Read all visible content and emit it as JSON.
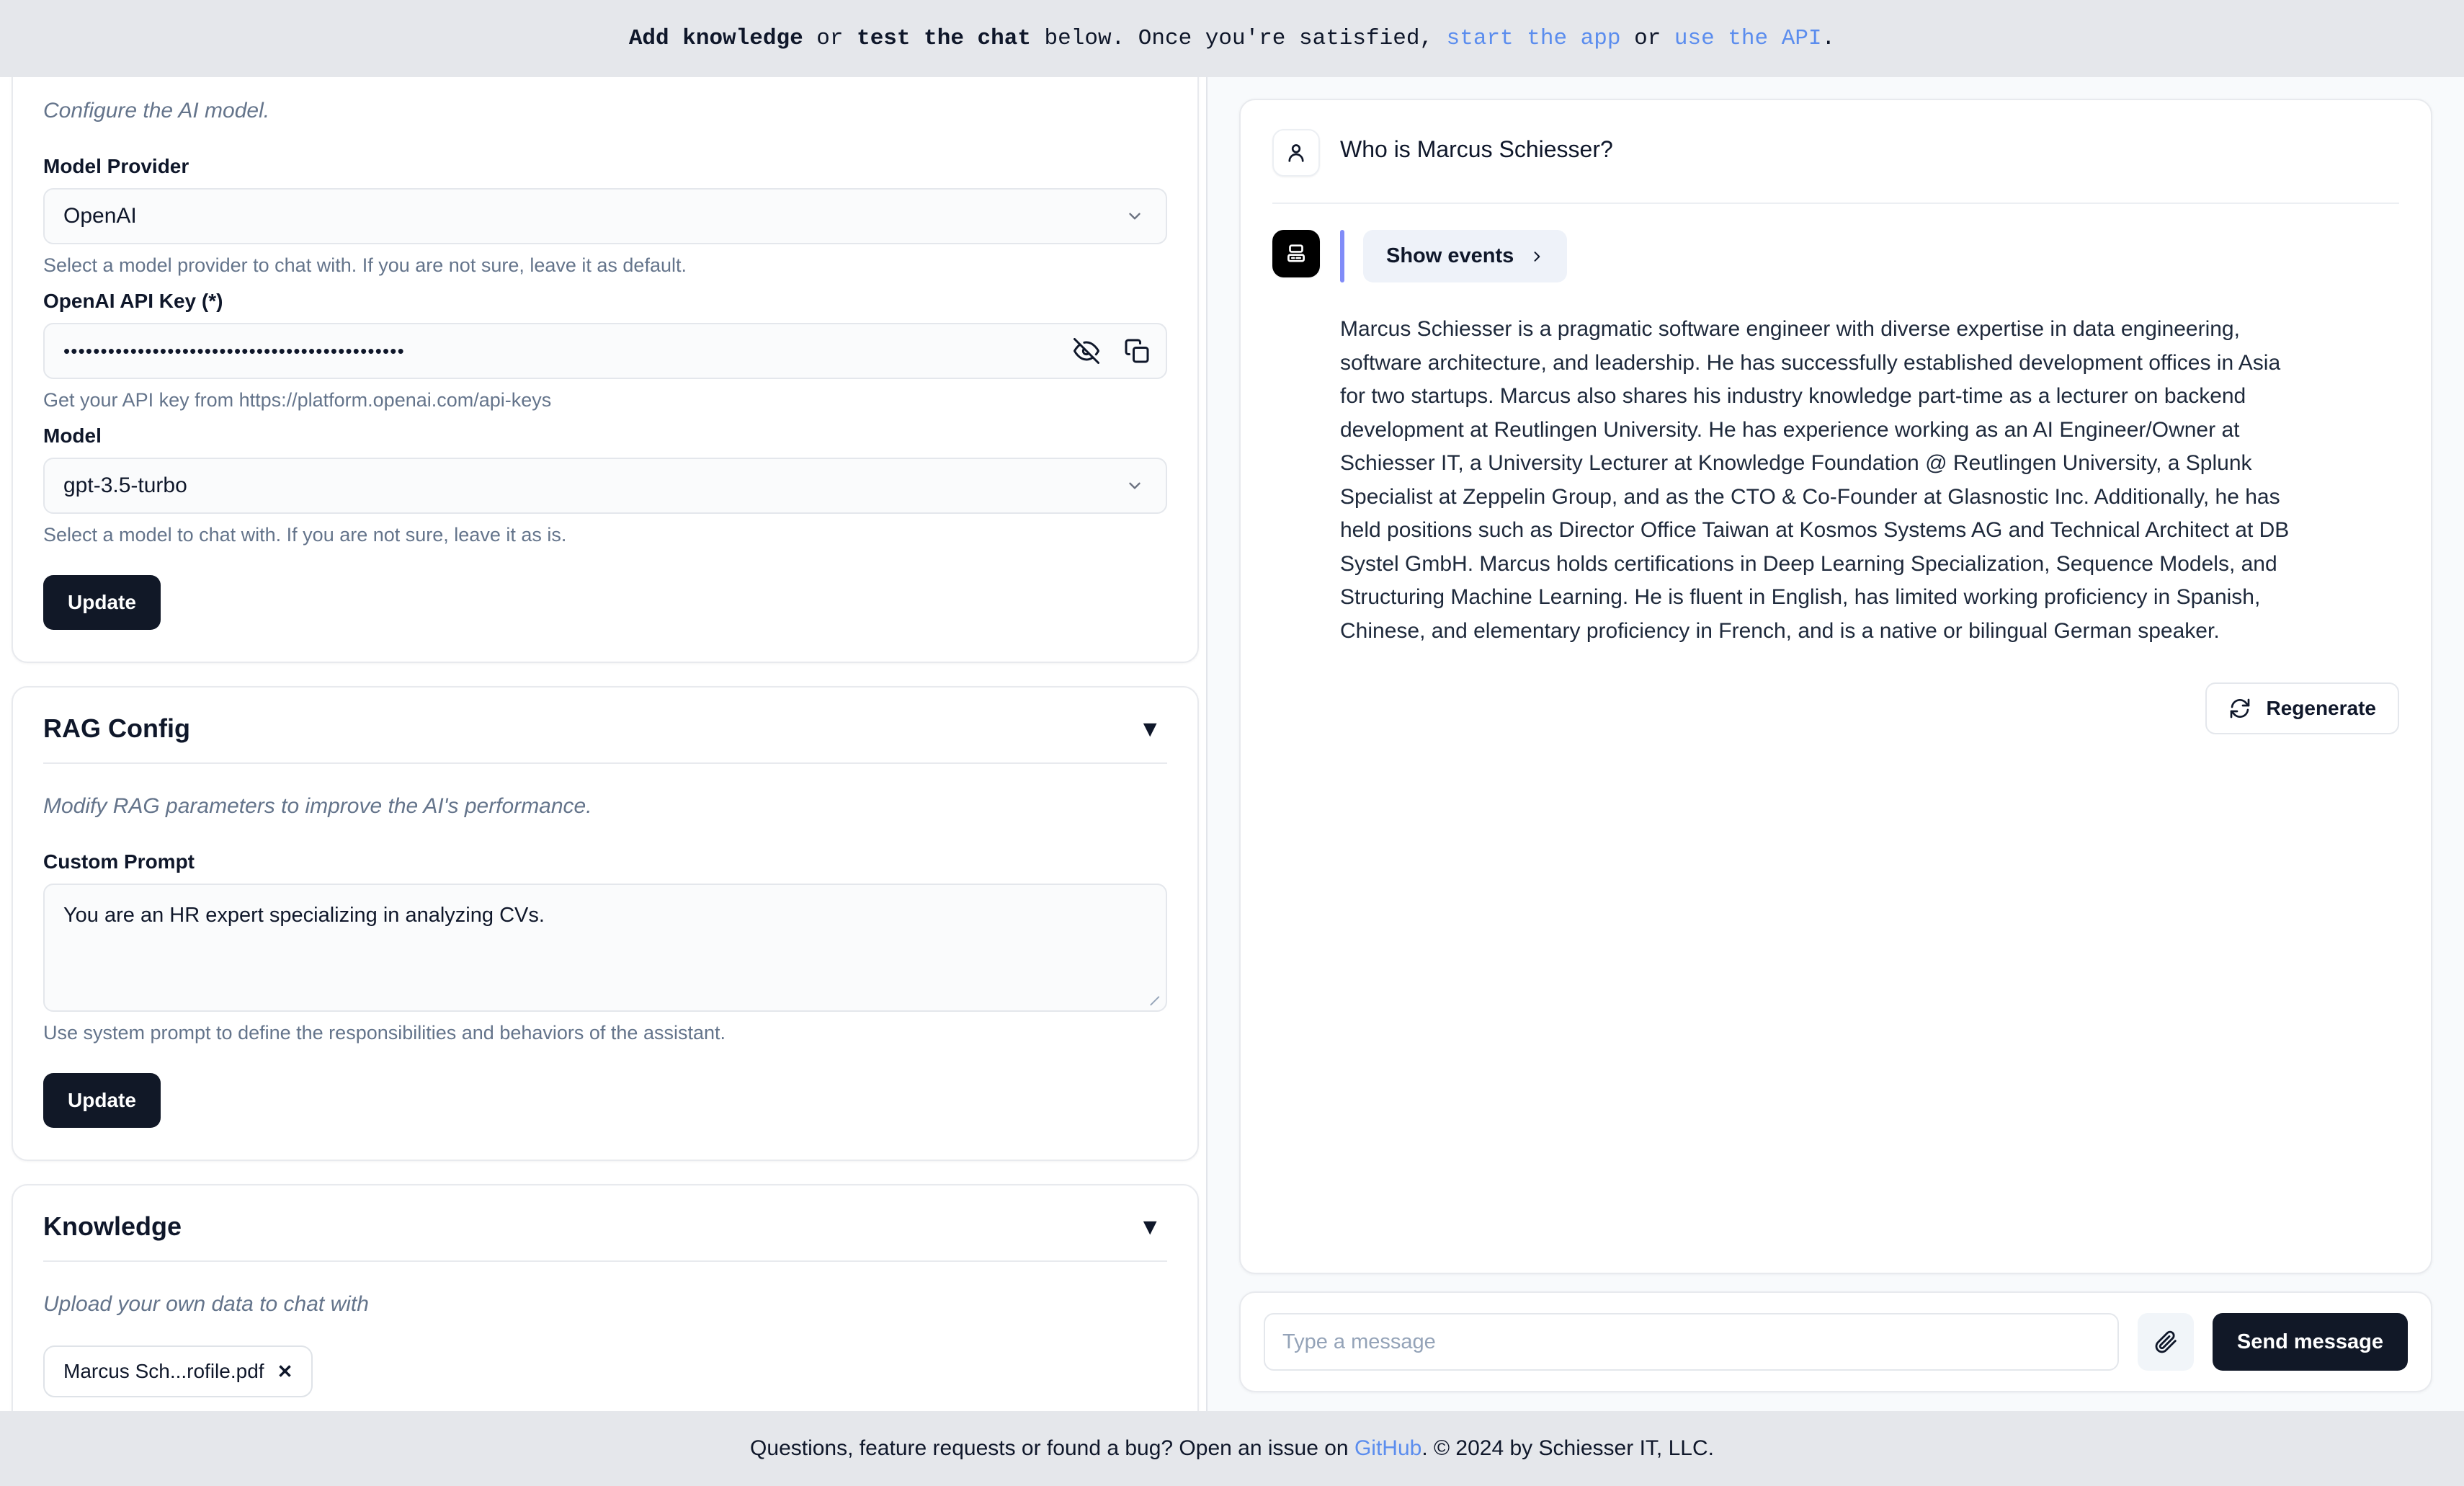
{
  "banner": {
    "part1_bold": "Add knowledge",
    "part2": " or ",
    "part3_bold": "test the chat",
    "part4": " below. Once you're satisfied, ",
    "link1": "start the app",
    "part5": " or ",
    "link2": "use the API",
    "part6": "."
  },
  "model_card": {
    "description": "Configure the AI model.",
    "provider_label": "Model Provider",
    "provider_value": "OpenAI",
    "provider_help": "Select a model provider to chat with. If you are not sure, leave it as default.",
    "apikey_label": "OpenAI API Key (*)",
    "apikey_value": "••••••••••••••••••••••••••••••••••••••••••••••",
    "apikey_help": "Get your API key from https://platform.openai.com/api-keys",
    "model_label": "Model",
    "model_value": "gpt-3.5-turbo",
    "model_help": "Select a model to chat with. If you are not sure, leave it as is.",
    "update_label": "Update",
    "toggle_visibility_icon": "eye-off-icon",
    "copy_icon": "copy-icon",
    "chevron_icon": "chevron-down-icon"
  },
  "rag_card": {
    "title": "RAG Config",
    "caret": "▼",
    "description": "Modify RAG parameters to improve the AI's performance.",
    "prompt_label": "Custom Prompt",
    "prompt_value": "You are an HR expert specializing in analyzing CVs.",
    "prompt_help": "Use system prompt to define the responsibilities and behaviors of the assistant.",
    "update_label": "Update"
  },
  "knowledge_card": {
    "title": "Knowledge",
    "caret": "▼",
    "description": "Upload your own data to chat with",
    "file_name": "Marcus Sch...rofile.pdf",
    "file_remove": "✕"
  },
  "chat": {
    "user_message": "Who is Marcus Schiesser?",
    "show_events_label": "Show events",
    "show_events_chevron": "chevron-right-icon",
    "answer": "Marcus Schiesser is a pragmatic software engineer with diverse expertise in data engineering, software architecture, and leadership. He has successfully established development offices in Asia for two startups. Marcus also shares his industry knowledge part-time as a lecturer on backend development at Reutlingen University. He has experience working as an AI Engineer/Owner at Schiesser IT, a University Lecturer at Knowledge Foundation @ Reutlingen University, a Splunk Specialist at Zeppelin Group, and as the CTO & Co-Founder at Glasnostic Inc. Additionally, he has held positions such as Director Office Taiwan at Kosmos Systems AG and Technical Architect at DB Systel GmbH. Marcus holds certifications in Deep Learning Specialization, Sequence Models, and Structuring Machine Learning. He is fluent in English, has limited working proficiency in Spanish, Chinese, and elementary proficiency in French, and is a native or bilingual German speaker.",
    "regenerate_label": "Regenerate",
    "regenerate_icon": "refresh-icon",
    "user_icon": "user-icon",
    "bot_icon": "bot-icon",
    "accent_color": "#818cf8"
  },
  "composer": {
    "placeholder": "Type a message",
    "value": "",
    "attach_icon": "paperclip-icon",
    "send_label": "Send message"
  },
  "footer": {
    "part1": "Questions, feature requests or found a bug? Open an issue on ",
    "link": "GitHub",
    "part2": ". © 2024 by Schiesser IT, LLC."
  }
}
